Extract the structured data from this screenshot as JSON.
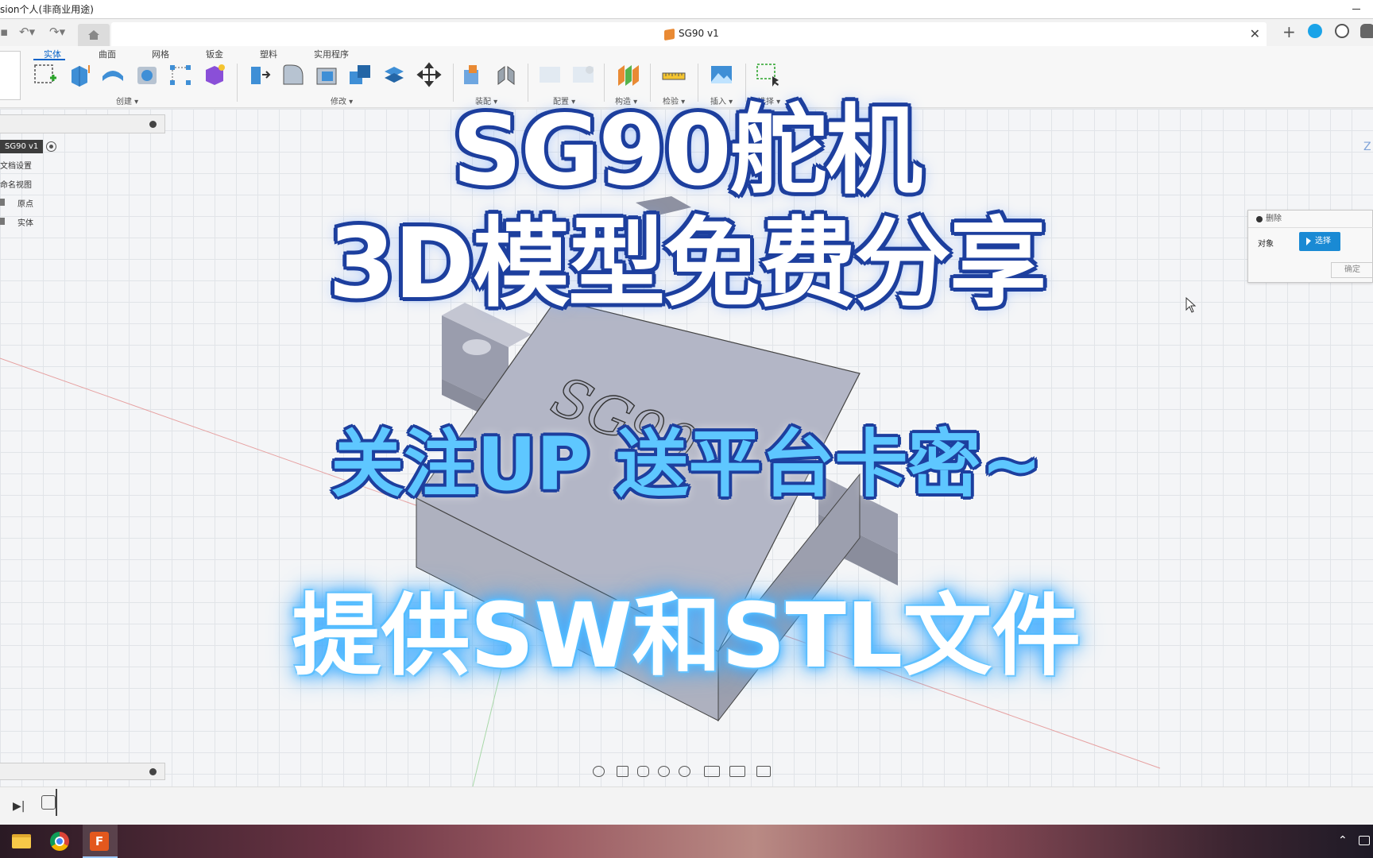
{
  "window": {
    "title": "sion个人(非商业用途)"
  },
  "document": {
    "tab_title": "SG90 v1"
  },
  "ribbon": {
    "tabs": [
      "实体",
      "曲面",
      "网格",
      "钣金",
      "塑料",
      "实用程序"
    ],
    "active_tab": "实体",
    "groups": [
      "创建 ▾",
      "修改 ▾",
      "装配 ▾",
      "配置 ▾",
      "构造 ▾",
      "检验 ▾",
      "插入 ▾",
      "选择 ▾"
    ]
  },
  "browser": {
    "root": "SG90 v1",
    "items": [
      "文档设置",
      "命名视图",
      "原点",
      "实体"
    ]
  },
  "delete_panel": {
    "title": "删除",
    "objects_label": "对象",
    "select_label": "选择",
    "ok_label": "确定"
  },
  "model": {
    "engraved_text": "SG90"
  },
  "overlay": {
    "title_line1": "SG90舵机",
    "title_line2": "3D模型免费分享",
    "subtitle": "关注UP 送平台卡密~",
    "subtitle2": "提供SW和STL文件"
  },
  "taskbar": {
    "apps": [
      "file-explorer",
      "chrome",
      "fusion-360"
    ],
    "fusion_letter": "F"
  },
  "colors": {
    "accent": "#0a64c8",
    "overlay_outline": "#1d3f9e",
    "subtitle_fill": "#5ec7ff",
    "model_body": "#b3b6c6",
    "select_button": "#1a8ad4"
  }
}
